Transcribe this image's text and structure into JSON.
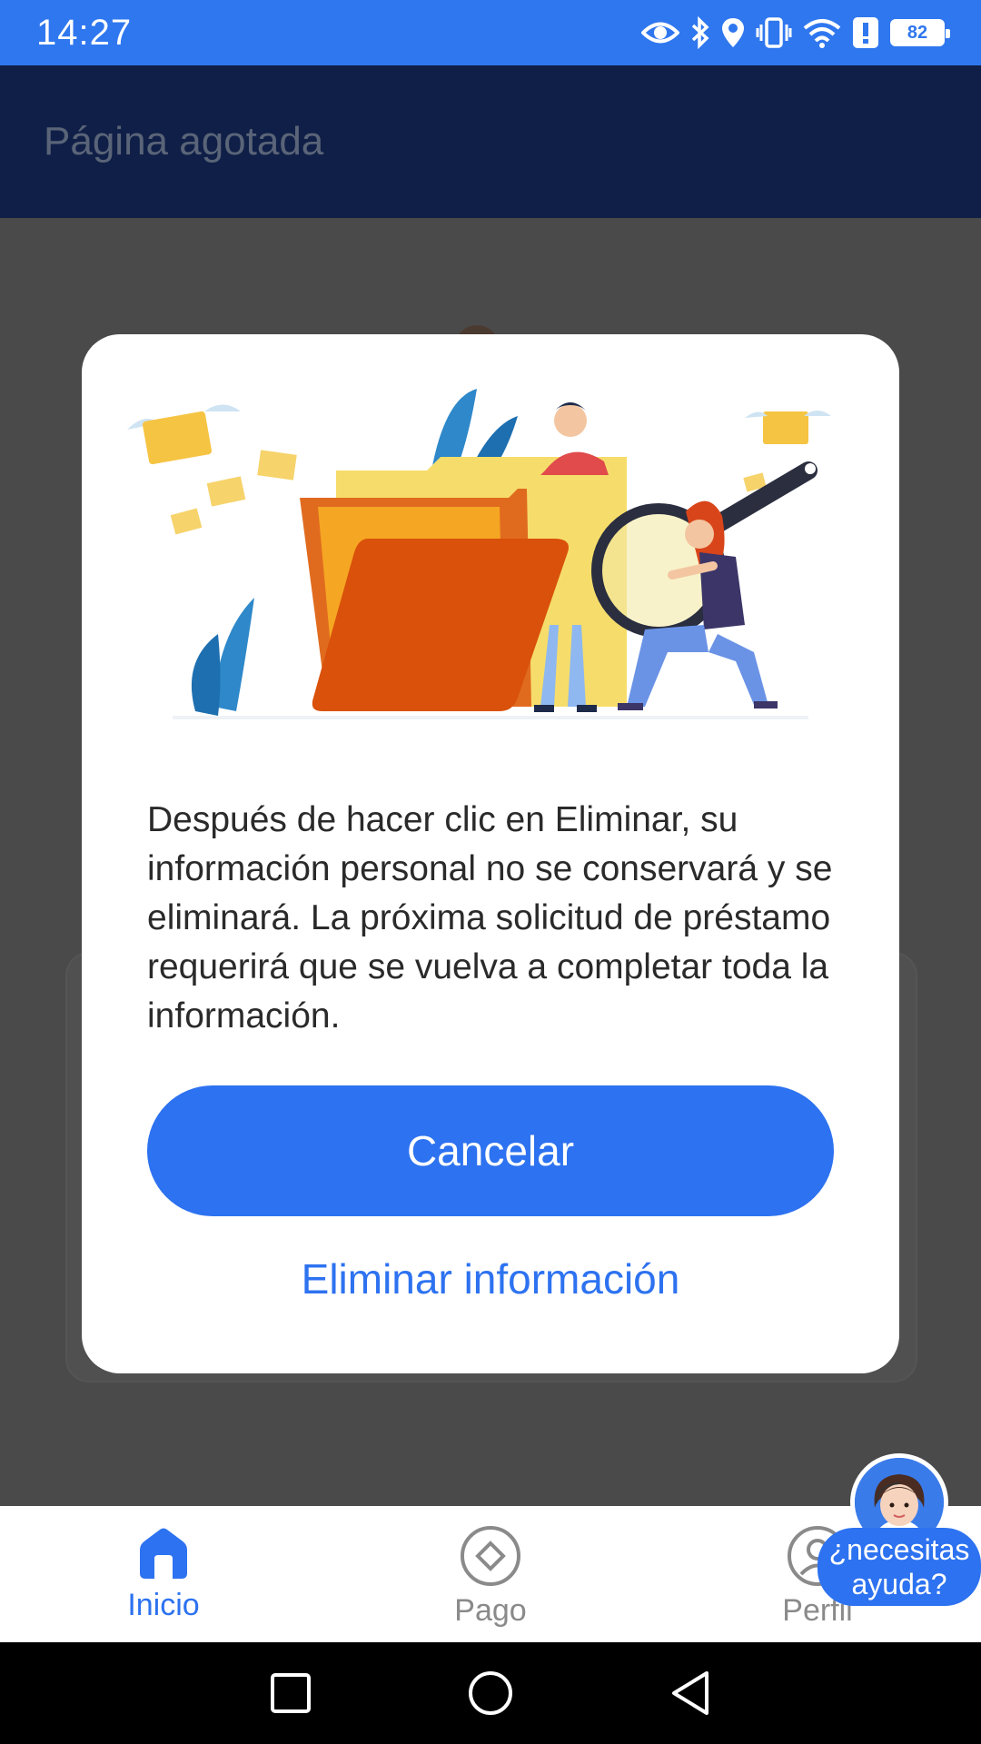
{
  "status_bar": {
    "time": "14:27",
    "battery": "82"
  },
  "app_bar": {
    "title": "Página agotada"
  },
  "modal": {
    "message": "Después de hacer clic en Eliminar, su información personal no se conservará y se eliminará. La próxima solicitud de préstamo requerirá que se vuelva a completar toda la información.",
    "cancel_label": "Cancelar",
    "delete_label": "Eliminar información"
  },
  "bottom_nav": {
    "items": [
      {
        "label": "Inicio",
        "icon": "home-icon",
        "active": true
      },
      {
        "label": "Pago",
        "icon": "diamond-icon",
        "active": false
      },
      {
        "label": "Perfil",
        "icon": "profile-icon",
        "active": false
      }
    ]
  },
  "help": {
    "label": "¿necesitas ayuda?"
  },
  "colors": {
    "accent": "#2d72f0",
    "status_bar": "#2f77ef",
    "app_bar": "#0f1f47",
    "overlay": "#4a4a4a"
  }
}
